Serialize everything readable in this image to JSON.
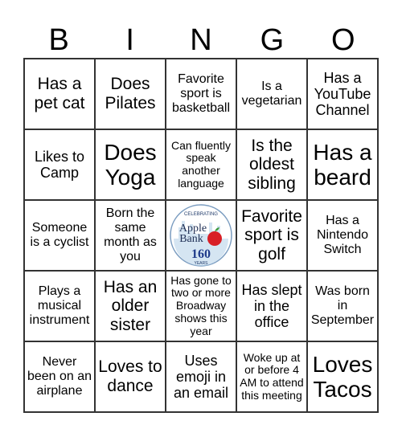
{
  "header": [
    "B",
    "I",
    "N",
    "G",
    "O"
  ],
  "cells": [
    "Has a pet cat",
    "Does Pilates",
    "Favorite sport is basketball",
    "Is a vegetarian",
    "Has a YouTube Channel",
    "Likes to Camp",
    "Does Yoga",
    "Can fluently speak another language",
    "Is the oldest sibling",
    "Has a beard",
    "Someone is a cyclist",
    "Born the same month as you",
    "",
    "Favorite sport is golf",
    "Has a Nintendo Switch",
    "Plays a musical instrument",
    "Has an older sister",
    "Has gone to two or more Broadway shows this year",
    "Has slept in the office",
    "Was born in September",
    "Never been on an airplane",
    "Loves to dance",
    "Uses emoji in an email",
    "Woke up at or before 4 AM to attend this meeting",
    "Loves Tacos"
  ],
  "logo": {
    "top": "CELEBRATING",
    "line1": "Apple",
    "line2": "Bank",
    "number": "160",
    "bottom": "YEARS",
    "icon": "apple-icon"
  }
}
